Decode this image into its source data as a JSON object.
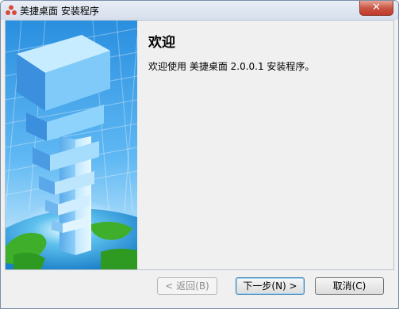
{
  "window": {
    "title": "美捷桌面 安装程序",
    "close_glyph": "✕"
  },
  "welcome": {
    "heading": "欢迎",
    "message": "欢迎使用 美捷桌面 2.0.0.1 安装程序。"
  },
  "buttons": {
    "back": "< 返回(B)",
    "next": "下一步(N) >",
    "cancel": "取消(C)"
  },
  "colors": {
    "close_red": "#c75140",
    "banner_sky": "#1d8fe4",
    "banner_earth": "#3fae2a",
    "default_button_border": "#3c7fb1"
  },
  "icons": {
    "app": "app-logo-icon",
    "close": "close-icon"
  }
}
